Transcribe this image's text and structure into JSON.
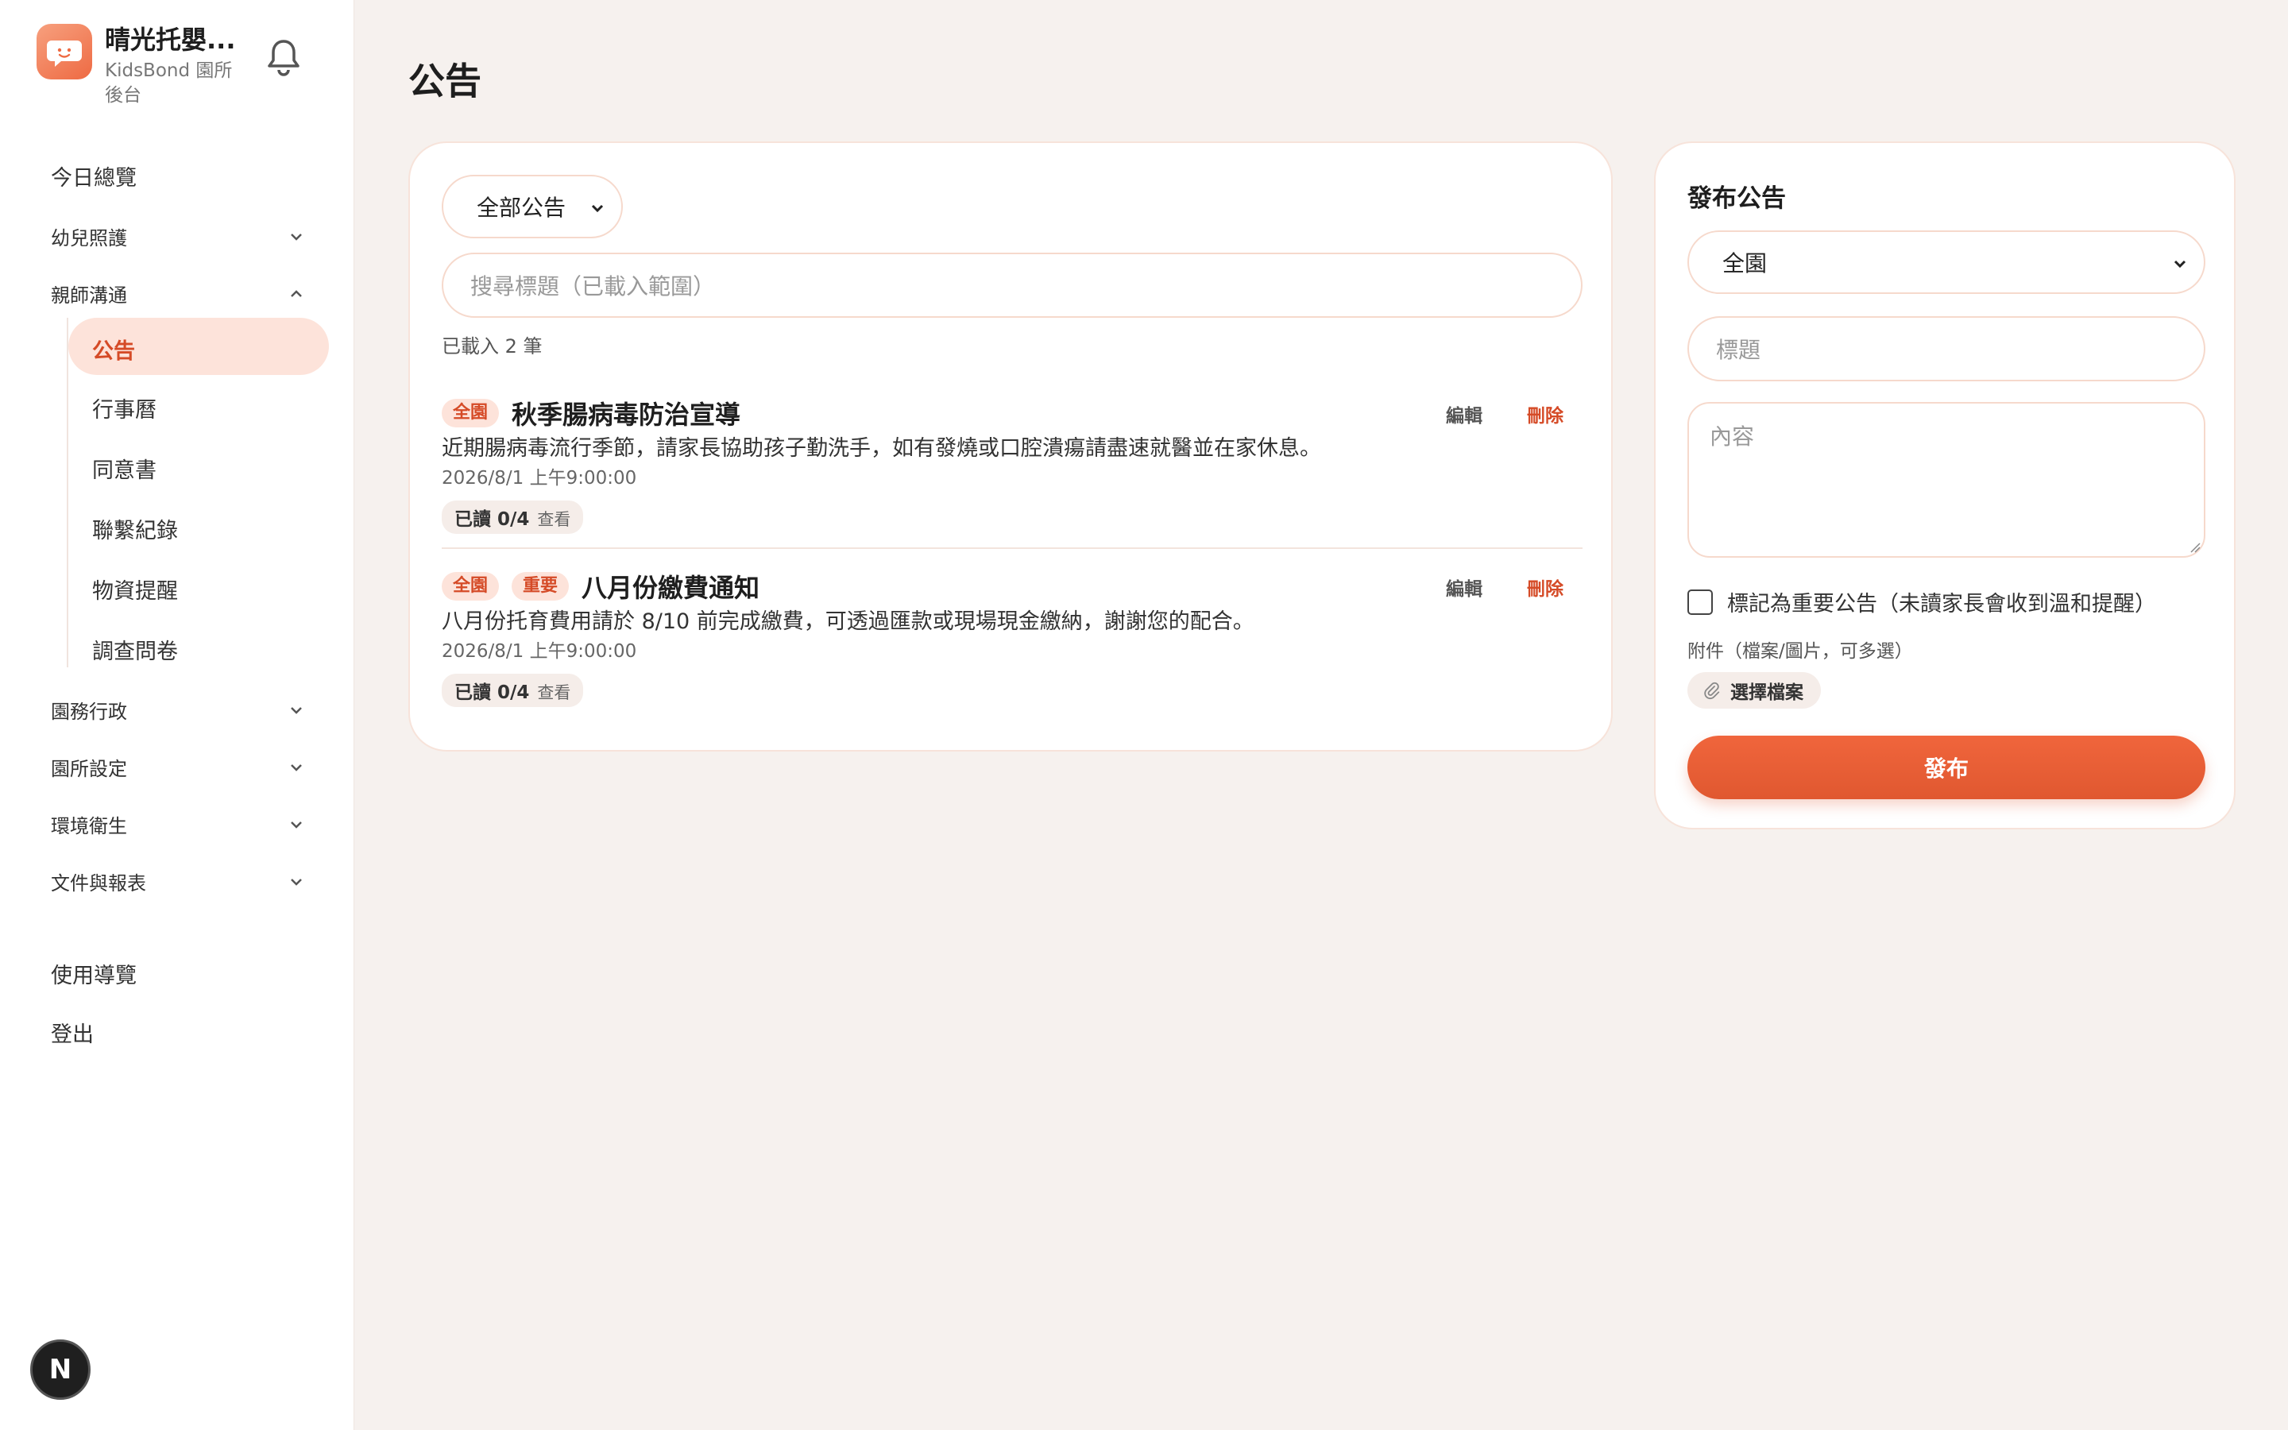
{
  "brand": {
    "title": "晴光托嬰...",
    "subtitle": "KidsBond 園所後台"
  },
  "sidebar": {
    "top_items": [
      "今日總覽"
    ],
    "groups": [
      "幼兒照護",
      "親師溝通",
      "園務行政",
      "園所設定",
      "環境衛生",
      "文件與報表"
    ],
    "sub_items": [
      "公告",
      "行事曆",
      "同意書",
      "聯繫紀錄",
      "物資提醒",
      "調查問卷"
    ],
    "bottom_items": [
      "使用導覽",
      "登出"
    ]
  },
  "page": {
    "title": "公告"
  },
  "list": {
    "filter_value": "全部公告",
    "search_placeholder": "搜尋標題（已載入範圍）",
    "count_text": "已載入 2 筆",
    "edit_label": "編輯",
    "delete_label": "刪除",
    "announcements": [
      {
        "tags": [
          "全園"
        ],
        "title": "秋季腸病毒防治宣導",
        "body": "近期腸病毒流行季節，請家長協助孩子勤洗手，如有發燒或口腔潰瘍請盡速就醫並在家休息。",
        "date": "2026/8/1 上午9:00:00",
        "read": "已讀 0/4",
        "view": "查看"
      },
      {
        "tags": [
          "全園",
          "重要"
        ],
        "title": "八月份繳費通知",
        "body": "八月份托育費用請於 8/10 前完成繳費，可透過匯款或現場現金繳納，謝謝您的配合。",
        "date": "2026/8/1 上午9:00:00",
        "read": "已讀 0/4",
        "view": "查看"
      }
    ]
  },
  "form": {
    "title": "發布公告",
    "audience": "全園",
    "title_placeholder": "標題",
    "content_placeholder": "內容",
    "important_label": "標記為重要公告（未讀家長會收到溫和提醒）",
    "attachment_label": "附件（檔案/圖片，可多選）",
    "file_button": "選擇檔案",
    "publish_button": "發布"
  },
  "icons": {
    "logo": "chat-bubble-face-icon",
    "bell": "bell-icon",
    "chevron": "chevron-icon",
    "paperclip": "paperclip-icon",
    "dev_badge": "next-badge-icon"
  },
  "colors": {
    "accent": "#e9603a",
    "tag_bg": "#fde3da",
    "background": "#f6f1ee"
  }
}
